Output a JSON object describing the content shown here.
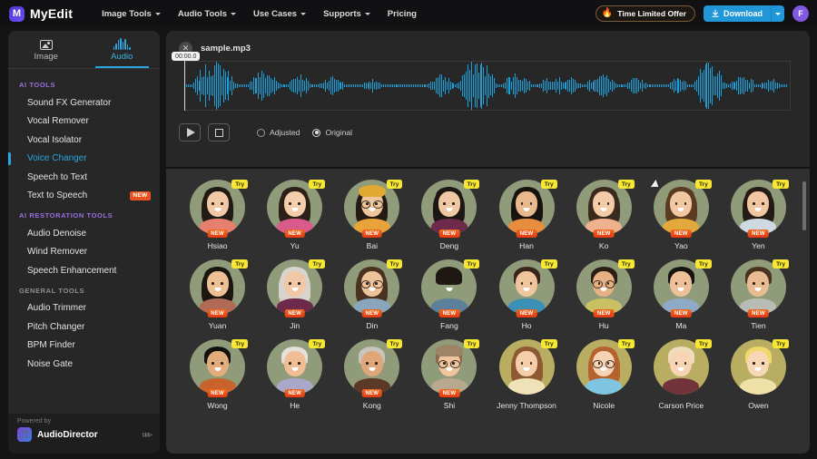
{
  "topbar": {
    "brand_mark": "M",
    "brand_name": "MyEdit",
    "nav": [
      {
        "label": "Image Tools",
        "has_caret": true
      },
      {
        "label": "Audio Tools",
        "has_caret": true
      },
      {
        "label": "Use Cases",
        "has_caret": true
      },
      {
        "label": "Supports",
        "has_caret": true
      },
      {
        "label": "Pricing",
        "has_caret": false
      }
    ],
    "offer_label": "Time Limited Offer",
    "offer_icon": "fire-clock-icon",
    "download_label": "Download",
    "download_icon": "download-icon",
    "account_initial": "F",
    "accent_blue": "#2196d9",
    "accent_purple": "#8158e0"
  },
  "sidebar": {
    "tabs": [
      {
        "label": "Image",
        "icon": "image-icon",
        "active": false
      },
      {
        "label": "Audio",
        "icon": "waveform-icon",
        "active": true
      }
    ],
    "sections": [
      {
        "title": "AI TOOLS",
        "title_color": "#9a6fe0",
        "items": [
          {
            "label": "Sound FX Generator",
            "active": false,
            "badge": null
          },
          {
            "label": "Vocal Remover",
            "active": false,
            "badge": null
          },
          {
            "label": "Vocal Isolator",
            "active": false,
            "badge": null
          },
          {
            "label": "Voice Changer",
            "active": true,
            "badge": null
          },
          {
            "label": "Speech to Text",
            "active": false,
            "badge": null
          },
          {
            "label": "Text to Speech",
            "active": false,
            "badge": "NEW"
          }
        ]
      },
      {
        "title": "AI RESTORATION TOOLS",
        "title_color": "#9a6fe0",
        "items": [
          {
            "label": "Audio Denoise",
            "active": false,
            "badge": null
          },
          {
            "label": "Wind Remover",
            "active": false,
            "badge": null
          },
          {
            "label": "Speech Enhancement",
            "active": false,
            "badge": null
          }
        ]
      },
      {
        "title": "GENERAL TOOLS",
        "title_color": "#8f8f8f",
        "items": [
          {
            "label": "Audio Trimmer",
            "active": false,
            "badge": null
          },
          {
            "label": "Pitch Changer",
            "active": false,
            "badge": null
          },
          {
            "label": "BPM Finder",
            "active": false,
            "badge": null
          },
          {
            "label": "Noise Gate",
            "active": false,
            "badge": null
          }
        ]
      }
    ],
    "powered": {
      "label": "Powered by",
      "product": "AudioDirector",
      "arrows": "≫",
      "logo_icon": "audiodirector-icon"
    }
  },
  "player": {
    "close_icon": "close-icon",
    "file_name": "sample.mp3",
    "time_label": "00:00.0",
    "waveform_color": "#1d9fd9",
    "play_icon": "play-icon",
    "stop_icon": "stop-icon",
    "modes": [
      {
        "label": "Adjusted",
        "selected": false
      },
      {
        "label": "Original",
        "selected": true
      }
    ]
  },
  "voices": {
    "try_label": "Try",
    "new_label": "NEW",
    "items": [
      {
        "name": "Hsiao",
        "badge": "NEW",
        "bg": "green"
      },
      {
        "name": "Yu",
        "badge": "NEW",
        "bg": "green"
      },
      {
        "name": "Bai",
        "badge": "NEW",
        "bg": "green"
      },
      {
        "name": "Deng",
        "badge": "NEW",
        "bg": "green"
      },
      {
        "name": "Han",
        "badge": "NEW",
        "bg": "green"
      },
      {
        "name": "Ko",
        "badge": "NEW",
        "bg": "green"
      },
      {
        "name": "Yao",
        "badge": "NEW",
        "bg": "green"
      },
      {
        "name": "Yen",
        "badge": "NEW",
        "bg": "green"
      },
      {
        "name": "Yuan",
        "badge": "NEW",
        "bg": "green"
      },
      {
        "name": "Jin",
        "badge": "NEW",
        "bg": "green"
      },
      {
        "name": "Din",
        "badge": "NEW",
        "bg": "green"
      },
      {
        "name": "Fang",
        "badge": "NEW",
        "bg": "green"
      },
      {
        "name": "Ho",
        "badge": "NEW",
        "bg": "green"
      },
      {
        "name": "Hu",
        "badge": "NEW",
        "bg": "green"
      },
      {
        "name": "Ma",
        "badge": "NEW",
        "bg": "green"
      },
      {
        "name": "Tien",
        "badge": "NEW",
        "bg": "green"
      },
      {
        "name": "Wong",
        "badge": "NEW",
        "bg": "green"
      },
      {
        "name": "He",
        "badge": "NEW",
        "bg": "green"
      },
      {
        "name": "Kong",
        "badge": "NEW",
        "bg": "green"
      },
      {
        "name": "Shi",
        "badge": "NEW",
        "bg": "green"
      },
      {
        "name": "Jenny Thompson",
        "badge": null,
        "bg": "olive"
      },
      {
        "name": "Nicole",
        "badge": null,
        "bg": "olive"
      },
      {
        "name": "Carson Price",
        "badge": null,
        "bg": "olive"
      },
      {
        "name": "Owen",
        "badge": null,
        "bg": "olive"
      }
    ]
  }
}
